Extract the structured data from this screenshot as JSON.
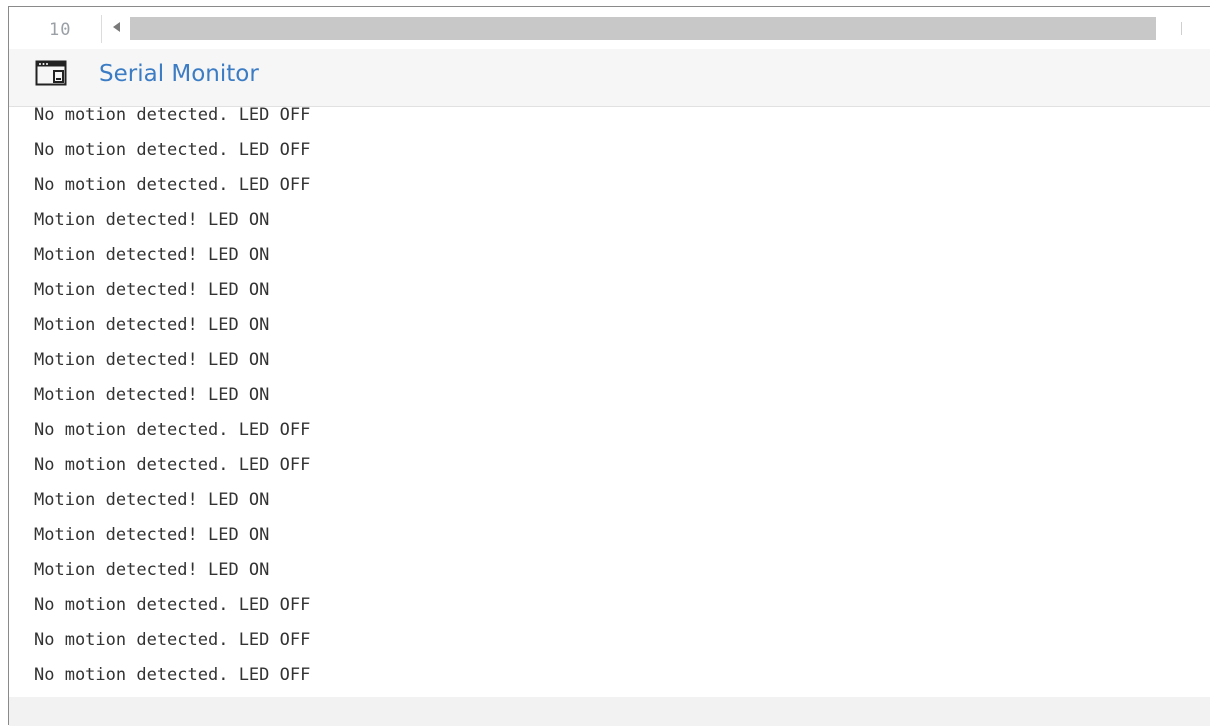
{
  "editor": {
    "line_number": "10",
    "scroll_left_icon": "triangle-left-icon"
  },
  "header": {
    "title": "Serial Monitor",
    "icon": "terminal-window-icon",
    "title_color": "#3b7cc4"
  },
  "output": {
    "lines": [
      "No motion detected. LED OFF",
      "No motion detected. LED OFF",
      "No motion detected. LED OFF",
      "Motion detected! LED ON",
      "Motion detected! LED ON",
      "Motion detected! LED ON",
      "Motion detected! LED ON",
      "Motion detected! LED ON",
      "Motion detected! LED ON",
      "No motion detected. LED OFF",
      "No motion detected. LED OFF",
      "Motion detected! LED ON",
      "Motion detected! LED ON",
      "Motion detected! LED ON",
      "No motion detected. LED OFF",
      "No motion detected. LED OFF",
      "No motion detected. LED OFF"
    ]
  }
}
